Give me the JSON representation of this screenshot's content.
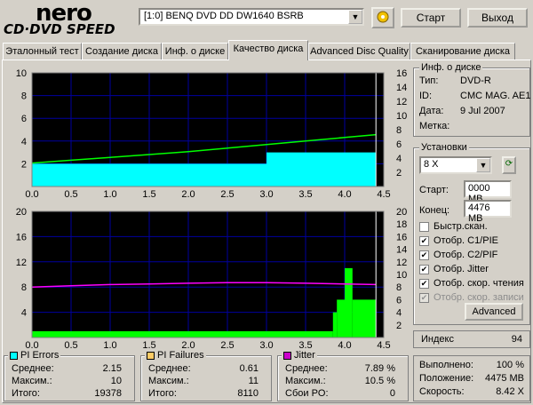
{
  "logo": {
    "brand": "nero",
    "product": "CD·DVD SPEED"
  },
  "toolbar": {
    "drive": "[1:0]  BENQ DVD DD DW1640 BSRB",
    "start_label": "Старт",
    "exit_label": "Выход"
  },
  "tabs": [
    {
      "label": "Эталонный тест"
    },
    {
      "label": "Создание диска"
    },
    {
      "label": "Инф. о диске"
    },
    {
      "label": "Качество диска"
    },
    {
      "label": "Advanced Disc Quality"
    },
    {
      "label": "Сканирование диска"
    }
  ],
  "disc_info": {
    "title": "Инф. о диске",
    "type_label": "Тип:",
    "type_value": "DVD-R",
    "id_label": "ID:",
    "id_value": "CMC MAG. AE1",
    "date_label": "Дата:",
    "date_value": "9 Jul 2007",
    "mark_label": "Метка:",
    "mark_value": ""
  },
  "settings": {
    "title": "Установки",
    "speed": "8 X",
    "start_label": "Старт:",
    "start_value": "0000 MB",
    "end_label": "Конец:",
    "end_value": "4476 MB",
    "options": [
      {
        "label": "Быстр.скан.",
        "checked": false,
        "enabled": true
      },
      {
        "label": "Отобр. C1/PIE",
        "checked": true,
        "enabled": true
      },
      {
        "label": "Отобр. C2/PIF",
        "checked": true,
        "enabled": true
      },
      {
        "label": "Отобр. Jitter",
        "checked": true,
        "enabled": true
      },
      {
        "label": "Отобр. скор. чтения",
        "checked": true,
        "enabled": true
      },
      {
        "label": "Отобр. скор. записи",
        "checked": true,
        "enabled": false
      }
    ],
    "advanced_label": "Advanced"
  },
  "index": {
    "label": "Индекс",
    "value": "94"
  },
  "progress": {
    "done_label": "Выполнено:",
    "done_value": "100 %",
    "position_label": "Положение:",
    "position_value": "4475 MB",
    "speed_label": "Скорость:",
    "speed_value": "8.42 X"
  },
  "pi_errors": {
    "title": "PI Errors",
    "avg_label": "Среднее:",
    "avg": "2.15",
    "max_label": "Максим.:",
    "max": "10",
    "total_label": "Итого:",
    "total": "19378"
  },
  "pi_failures": {
    "title": "PI Failures",
    "avg_label": "Среднее:",
    "avg": "0.61",
    "max_label": "Максим.:",
    "max": "11",
    "total_label": "Итого:",
    "total": "8110"
  },
  "jitter": {
    "title": "Jitter",
    "avg_label": "Среднее:",
    "avg": "7.89 %",
    "max_label": "Максим.:",
    "max": "10.5 %",
    "po_label": "Сбои PO:",
    "po": "0"
  },
  "colors": {
    "pie": "#00ffff",
    "pif": "#00ff00",
    "jitter": "#ff00ff",
    "speed": "#00ff00",
    "chart_bg": "#000000",
    "grid": "#0000a0",
    "accent_square_pie": "#00ffff",
    "accent_square_pif": "#ffcc66",
    "accent_square_jitter": "#cc00cc"
  },
  "chart_data": [
    {
      "type": "area",
      "xlim": [
        0,
        4.5
      ],
      "ylim_left": [
        0,
        10
      ],
      "ylim_right": [
        0,
        16
      ],
      "x_ticks": [
        "0.0",
        "0.5",
        "1.0",
        "1.5",
        "2.0",
        "2.5",
        "3.0",
        "3.5",
        "4.0",
        "4.5"
      ],
      "y_ticks_left": [
        "10",
        "8",
        "6",
        "4",
        "2"
      ],
      "y_ticks_right": [
        "16",
        "14",
        "12",
        "10",
        "8",
        "6",
        "4",
        "2"
      ],
      "series": [
        {
          "name": "PI Errors",
          "x": [
            0.0,
            0.25,
            0.5,
            0.75,
            1.0,
            1.25,
            1.5,
            1.75,
            2.0,
            2.25,
            2.5,
            2.75,
            3.0,
            3.25,
            3.5,
            3.75,
            4.0,
            4.25,
            4.4
          ],
          "values": [
            2,
            2,
            2,
            2,
            2,
            2,
            2,
            2,
            2,
            2,
            2,
            2,
            3,
            3,
            3,
            3,
            3,
            3,
            3
          ]
        },
        {
          "name": "Speed",
          "x": [
            0.0,
            0.5,
            1.0,
            1.5,
            2.0,
            2.5,
            3.0,
            3.5,
            4.0,
            4.4
          ],
          "values": [
            3.3,
            3.7,
            4.1,
            4.5,
            4.9,
            5.4,
            5.9,
            6.4,
            6.9,
            7.3
          ]
        }
      ]
    },
    {
      "type": "bar",
      "xlim": [
        0,
        4.5
      ],
      "ylim_left": [
        0,
        20
      ],
      "ylim_right": [
        0,
        20
      ],
      "x_ticks": [
        "0.0",
        "0.5",
        "1.0",
        "1.5",
        "2.0",
        "2.5",
        "3.0",
        "3.5",
        "4.0",
        "4.5"
      ],
      "y_ticks_left": [
        "20",
        "16",
        "12",
        "8",
        "4"
      ],
      "y_ticks_right": [
        "20",
        "18",
        "16",
        "14",
        "12",
        "10",
        "8",
        "6",
        "4",
        "2"
      ],
      "series": [
        {
          "name": "PI Failures",
          "x": [
            0.0,
            0.25,
            0.5,
            0.75,
            1.0,
            1.25,
            1.5,
            1.75,
            2.0,
            2.25,
            2.5,
            2.75,
            3.0,
            3.25,
            3.5,
            3.75,
            3.85,
            3.9,
            4.0,
            4.1,
            4.4
          ],
          "values": [
            1,
            1,
            1,
            1,
            1,
            1,
            1,
            1,
            1,
            1,
            1,
            1,
            1,
            1,
            1,
            1,
            4,
            6,
            11,
            6,
            1
          ]
        },
        {
          "name": "Jitter",
          "x": [
            0.0,
            0.5,
            1.0,
            1.5,
            2.0,
            2.5,
            3.0,
            3.5,
            4.0,
            4.4
          ],
          "values": [
            8.0,
            8.2,
            8.4,
            8.5,
            8.6,
            8.7,
            8.7,
            8.6,
            8.5,
            8.4
          ]
        }
      ]
    }
  ]
}
